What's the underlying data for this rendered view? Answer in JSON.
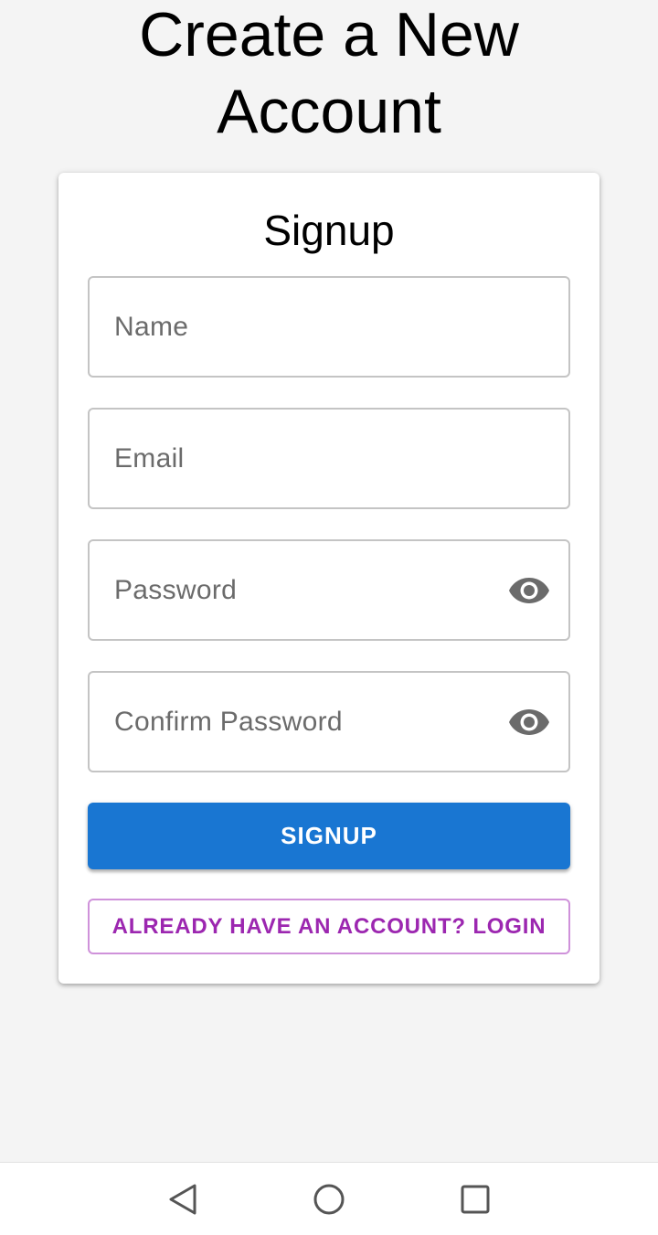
{
  "page": {
    "title_line1": "Create a New",
    "title_line2": "Account"
  },
  "form": {
    "title": "Signup",
    "fields": {
      "name": {
        "placeholder": "Name",
        "value": ""
      },
      "email": {
        "placeholder": "Email",
        "value": ""
      },
      "password": {
        "placeholder": "Password",
        "value": "",
        "toggle_icon": "eye-icon"
      },
      "confirm_password": {
        "placeholder": "Confirm Password",
        "value": "",
        "toggle_icon": "eye-icon"
      }
    },
    "submit_label": "SIGNUP",
    "login_label": "ALREADY HAVE AN ACCOUNT? LOGIN"
  },
  "navbar": {
    "back_icon": "back-triangle-icon",
    "home_icon": "home-circle-icon",
    "recents_icon": "recents-square-icon"
  },
  "colors": {
    "background": "#f4f4f4",
    "primary": "#1976d2",
    "secondary": "#9c27b0",
    "field_border": "#c4c4c4",
    "placeholder": "#6b6b6b"
  }
}
